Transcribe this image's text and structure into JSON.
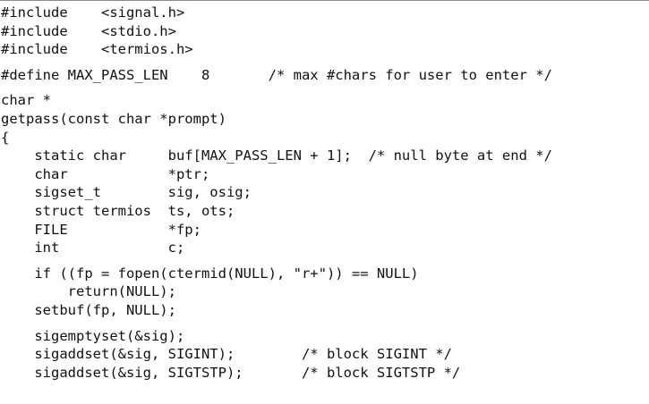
{
  "code_listing": {
    "lines": [
      {
        "text": "#include    <signal.h>",
        "gap_before": false
      },
      {
        "text": "#include    <stdio.h>",
        "gap_before": false
      },
      {
        "text": "#include    <termios.h>",
        "gap_before": false
      },
      {
        "text": "#define MAX_PASS_LEN    8       /* max #chars for user to enter */",
        "gap_before": true
      },
      {
        "text": "char *",
        "gap_before": true
      },
      {
        "text": "getpass(const char *prompt)",
        "gap_before": false
      },
      {
        "text": "{",
        "gap_before": false
      },
      {
        "text": "    static char     buf[MAX_PASS_LEN + 1];  /* null byte at end */",
        "gap_before": false
      },
      {
        "text": "    char            *ptr;",
        "gap_before": false
      },
      {
        "text": "    sigset_t        sig, osig;",
        "gap_before": false
      },
      {
        "text": "    struct termios  ts, ots;",
        "gap_before": false
      },
      {
        "text": "    FILE            *fp;",
        "gap_before": false
      },
      {
        "text": "    int             c;",
        "gap_before": false
      },
      {
        "text": "    if ((fp = fopen(ctermid(NULL), \"r+\")) == NULL)",
        "gap_before": true
      },
      {
        "text": "        return(NULL);",
        "gap_before": false
      },
      {
        "text": "    setbuf(fp, NULL);",
        "gap_before": false
      },
      {
        "text": "    sigemptyset(&sig);",
        "gap_before": true
      },
      {
        "text": "    sigaddset(&sig, SIGINT);        /* block SIGINT */",
        "gap_before": false
      },
      {
        "text": "    sigaddset(&sig, SIGTSTP);       /* block SIGTSTP */",
        "gap_before": false
      }
    ]
  }
}
